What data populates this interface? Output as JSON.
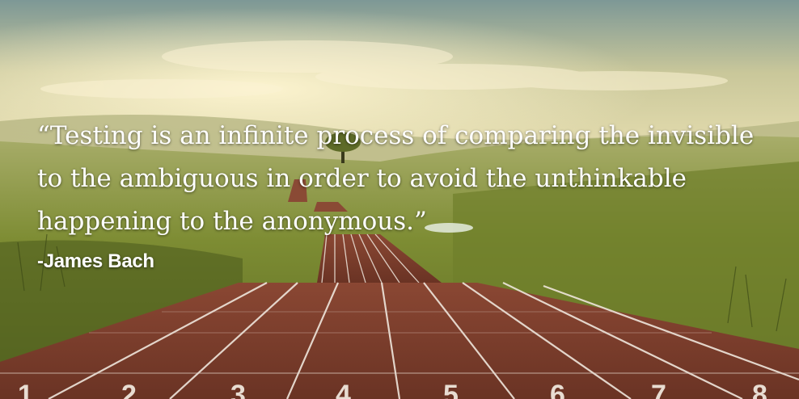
{
  "quote": {
    "lines": [
      "“Testing is an infinite process of comparing the invisible",
      "to the ambiguous in order to avoid the unthinkable",
      "happening to the anonymous.”"
    ],
    "author": "-James Bach"
  },
  "track": {
    "lane_numbers": [
      "1",
      "2",
      "3",
      "4",
      "5",
      "6",
      "7",
      "8"
    ]
  },
  "colors": {
    "sky_top": "#7f9a98",
    "sky_glow": "#f4e7b8",
    "grass": "#7e8e2e",
    "grass_dark": "#4f5a1c",
    "track": "#7a3d2a",
    "lane_line": "#efe6dc",
    "text": "#ffffff"
  }
}
